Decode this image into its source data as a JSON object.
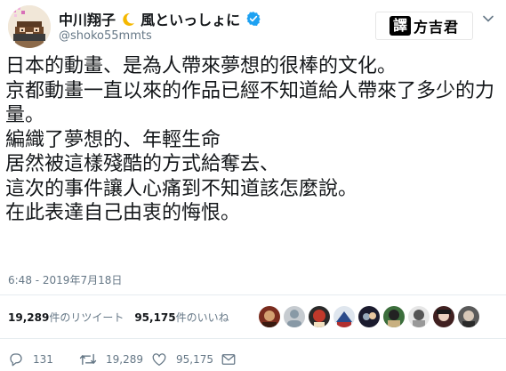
{
  "author": {
    "name_part1": "中川翔子",
    "name_part2": "風といっしょに",
    "handle": "@shoko55mmts",
    "verified": true
  },
  "watermark": {
    "part1": "譯",
    "part2": "方吉君"
  },
  "tweet": {
    "text": "日本的動畫、是為人帶來夢想的很棒的文化。\n京都動畫一直以來的作品已經不知道給人帶來了多少的力量。\n編織了夢想的、年輕生命\n居然被這樣殘酷的方式給奪去、\n這次的事件讓人心痛到不知道該怎麼說。\n在此表達自己由衷的悔恨。",
    "timestamp": "6:48 - 2019年7月18日"
  },
  "stats": {
    "retweets_count": "19,289",
    "retweets_label": "件のリツイート",
    "likes_count": "95,175",
    "likes_label": "件のいいね"
  },
  "actions": {
    "replies": "131",
    "retweets": "19,289",
    "likes": "95,175"
  },
  "icons": {
    "verified": "verified-badge-icon",
    "moon": "crescent-moon-icon",
    "chevron": "chevron-down-icon",
    "reply": "reply-icon",
    "retweet": "retweet-icon",
    "like": "heart-icon",
    "dm": "envelope-icon"
  },
  "colors": {
    "verified_blue": "#1da1f2",
    "secondary_text": "#657786",
    "primary_text": "#14171a",
    "divider": "#e6ecf0"
  }
}
